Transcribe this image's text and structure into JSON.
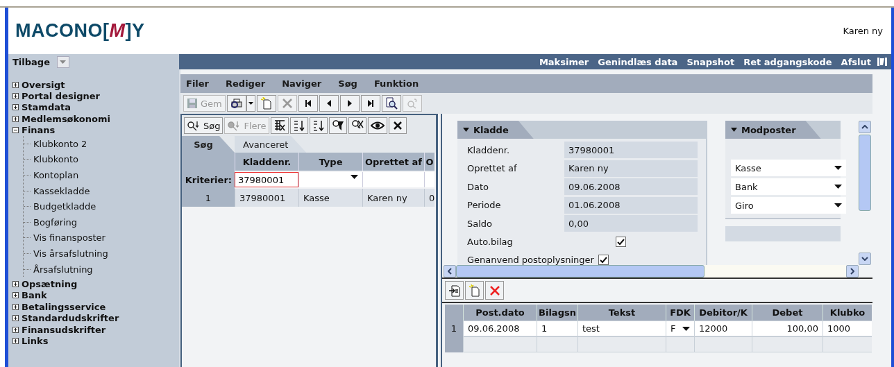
{
  "logo": {
    "text_before": "MACONO[",
    "mark": "M",
    "text_after": "]Y"
  },
  "user": "Karen ny",
  "back_button": {
    "label": "Tilbage"
  },
  "top_links": [
    {
      "label": "Maksimer"
    },
    {
      "label": "Genindlæs data"
    },
    {
      "label": "Snapshot"
    },
    {
      "label": "Ret adgangskode"
    },
    {
      "label": "Afslut"
    }
  ],
  "sidebar": {
    "items": [
      {
        "label": "Oversigt",
        "expanded": false
      },
      {
        "label": "Portal designer",
        "expanded": false
      },
      {
        "label": "Stamdata",
        "expanded": false
      },
      {
        "label": "Medlemsøkonomi",
        "expanded": false
      },
      {
        "label": "Finans",
        "expanded": true,
        "children": [
          {
            "label": "Klubkonto 2"
          },
          {
            "label": "Klubkonto"
          },
          {
            "label": "Kontoplan"
          },
          {
            "label": "Kassekladde"
          },
          {
            "label": "Budgetkladde"
          },
          {
            "label": "Bogføring"
          },
          {
            "label": "Vis finansposter"
          },
          {
            "label": "Vis årsafslutning"
          },
          {
            "label": "Årsafslutning"
          }
        ]
      },
      {
        "label": "Opsætning",
        "expanded": false
      },
      {
        "label": "Bank",
        "expanded": false
      },
      {
        "label": "Betalingsservice",
        "expanded": false
      },
      {
        "label": "Standardudskrifter",
        "expanded": false
      },
      {
        "label": "Finansudskrifter",
        "expanded": false
      },
      {
        "label": "Links",
        "expanded": false
      }
    ]
  },
  "menu": [
    {
      "label": "Filer"
    },
    {
      "label": "Rediger"
    },
    {
      "label": "Naviger"
    },
    {
      "label": "Søg"
    },
    {
      "label": "Funktion"
    }
  ],
  "toolbar": [
    {
      "kind": "save",
      "label": "Gem",
      "disabled": true
    },
    {
      "kind": "print",
      "disabled": false
    },
    {
      "kind": "new",
      "disabled": false
    },
    {
      "kind": "delete",
      "disabled": true
    },
    {
      "kind": "first",
      "disabled": false
    },
    {
      "kind": "prev",
      "disabled": false
    },
    {
      "kind": "next",
      "disabled": false
    },
    {
      "kind": "last",
      "disabled": false
    },
    {
      "kind": "preview",
      "disabled": false
    },
    {
      "kind": "help",
      "disabled": true
    }
  ],
  "search_panel": {
    "toolbar": [
      {
        "kind": "search",
        "label": "Søg",
        "disabled": false
      },
      {
        "kind": "more",
        "label": "Flere",
        "disabled": true
      },
      {
        "kind": "columns",
        "disabled": false
      },
      {
        "kind": "sort-asc",
        "disabled": false
      },
      {
        "kind": "sort-desc",
        "disabled": false
      },
      {
        "kind": "filter",
        "disabled": false
      },
      {
        "kind": "clear-filter",
        "disabled": false
      },
      {
        "kind": "view",
        "disabled": false
      },
      {
        "kind": "close",
        "disabled": false
      }
    ],
    "tabs": [
      {
        "label": "Søg",
        "selected": true
      },
      {
        "label": "Avanceret",
        "selected": false
      }
    ],
    "columns": [
      "Kladdenr.",
      "Type",
      "Oprettet af",
      "O"
    ],
    "criteria": {
      "label": "Kriterier:",
      "value": "37980001"
    },
    "rows": [
      {
        "index": "1",
        "cells": [
          "37980001",
          "Kasse",
          "Karen ny",
          "0"
        ]
      }
    ]
  },
  "kladde": {
    "title": "Kladde",
    "expanded": true,
    "fields": [
      {
        "label": "Kladdenr.",
        "value": "37980001"
      },
      {
        "label": "Oprettet af",
        "value": "Karen ny"
      },
      {
        "label": "Dato",
        "value": "09.06.2008"
      },
      {
        "label": "Periode",
        "value": "01.06.2008"
      },
      {
        "label": "Saldo",
        "value": "0,00"
      }
    ],
    "checkboxes": [
      {
        "label": "Auto.bilag",
        "checked": true
      },
      {
        "label": "Genanvend postoplysninger",
        "checked": true
      }
    ]
  },
  "modposter": {
    "title": "Modposter",
    "expanded": true,
    "selects": [
      {
        "value": "Kasse"
      },
      {
        "value": "Bank"
      },
      {
        "value": "Giro"
      }
    ]
  },
  "lines": {
    "toolbar": [
      {
        "kind": "insert"
      },
      {
        "kind": "new"
      },
      {
        "kind": "delete"
      }
    ],
    "columns": [
      "Post.dato",
      "Bilagsn",
      "Tekst",
      "FDK",
      "Debitor/K",
      "Debet",
      "Klubko"
    ],
    "rows": [
      {
        "index": "1",
        "cells": [
          {
            "kind": "text",
            "text": "09.06.2008"
          },
          {
            "kind": "text",
            "text": "1"
          },
          {
            "kind": "text",
            "text": "test"
          },
          {
            "kind": "select",
            "text": "F"
          },
          {
            "kind": "text",
            "text": "12000"
          },
          {
            "kind": "amount",
            "text": "100,00"
          },
          {
            "kind": "text",
            "text": "1000"
          }
        ]
      }
    ]
  }
}
